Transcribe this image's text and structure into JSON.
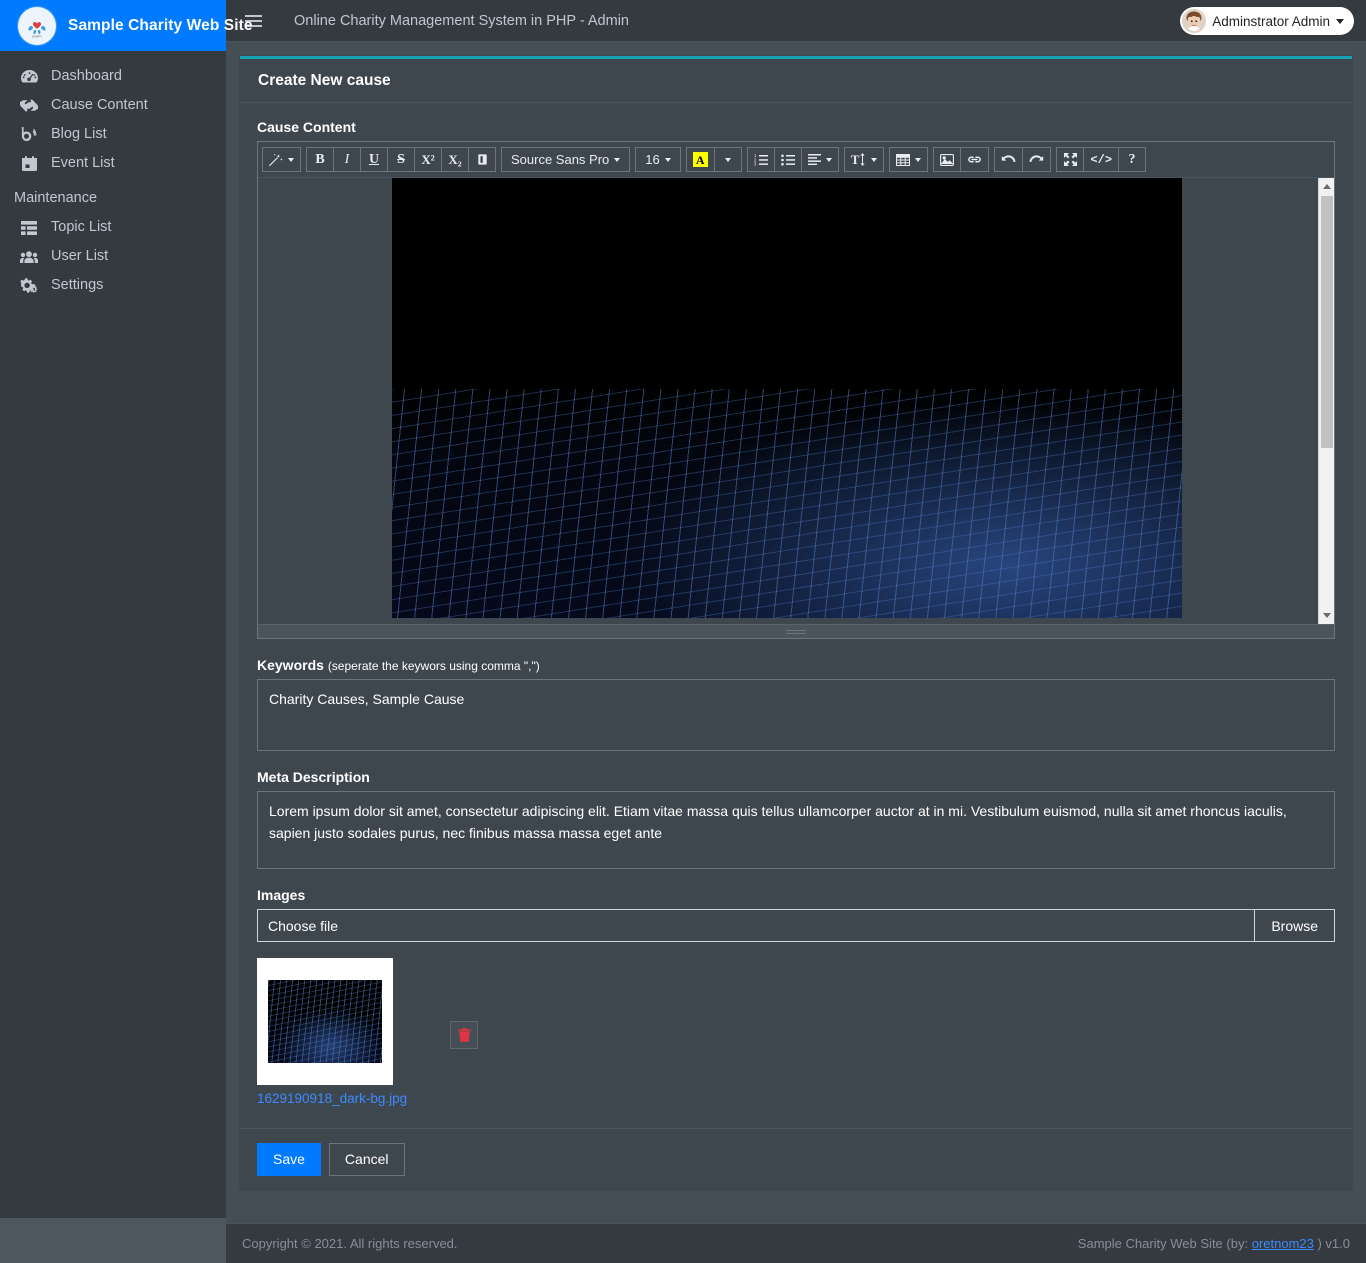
{
  "brand": {
    "name": "Sample Charity Web Site",
    "logo_icon": "charity-heart-hands-logo"
  },
  "sidebar": {
    "items": [
      {
        "label": "Dashboard",
        "icon": "tachometer-icon"
      },
      {
        "label": "Cause Content",
        "icon": "hands-helping-icon"
      },
      {
        "label": "Blog List",
        "icon": "blog-icon"
      },
      {
        "label": "Event List",
        "icon": "calendar-icon"
      }
    ],
    "section_header": "Maintenance",
    "maintenance_items": [
      {
        "label": "Topic List",
        "icon": "table-list-icon"
      },
      {
        "label": "User List",
        "icon": "users-icon"
      },
      {
        "label": "Settings",
        "icon": "cogs-icon"
      }
    ]
  },
  "topbar": {
    "menu_icon": "hamburger-icon",
    "title": "Online Charity Management System in PHP - Admin",
    "user": {
      "name": "Adminstrator Admin",
      "avatar_icon": "user-avatar",
      "caret_icon": "caret-down-icon"
    }
  },
  "page": {
    "card_title": "Create New cause",
    "accent_color": "#17a2b8"
  },
  "form": {
    "cause_content_label": "Cause Content",
    "keywords_label": "Keywords",
    "keywords_hint": "(seperate the keywors using comma \",\")",
    "keywords_value": "Charity Causes, Sample Cause",
    "meta_label": "Meta Description",
    "meta_value": "Lorem ipsum dolor sit amet, consectetur adipiscing elit. Etiam vitae massa quis tellus ullamcorper auctor at in mi. Vestibulum euismod, nulla sit amet rhoncus iaculis, sapien justo sodales purus, nec finibus massa massa eget ante",
    "images_label": "Images",
    "file_choose_text": "Choose file",
    "file_browse_text": "Browse",
    "uploaded_file_name": "1629190918_dark-bg.jpg",
    "delete_icon": "trash-icon",
    "save_label": "Save",
    "cancel_label": "Cancel"
  },
  "editor": {
    "toolbar": [
      {
        "group": [
          {
            "name": "magic-style-icon",
            "type": "icon",
            "caret": true
          }
        ]
      },
      {
        "group": [
          {
            "name": "bold-button",
            "type": "text",
            "label": "B",
            "style": "bold"
          },
          {
            "name": "italic-button",
            "type": "text",
            "label": "I",
            "style": "italic"
          },
          {
            "name": "underline-button",
            "type": "text",
            "label": "U",
            "style": "underline"
          },
          {
            "name": "strikethrough-button",
            "type": "text",
            "label": "S",
            "style": "strike"
          },
          {
            "name": "superscript-button",
            "type": "text",
            "label": "X²",
            "style": "plain"
          },
          {
            "name": "subscript-button",
            "type": "text",
            "label": "X₂",
            "style": "plain"
          },
          {
            "name": "eraser-button",
            "type": "icon"
          }
        ]
      },
      {
        "group": [
          {
            "name": "font-family-select",
            "type": "text",
            "label": "Source Sans Pro",
            "caret": true,
            "wide": true
          }
        ]
      },
      {
        "group": [
          {
            "name": "font-size-select",
            "type": "text",
            "label": "16",
            "caret": true,
            "wide": true
          }
        ]
      },
      {
        "group": [
          {
            "name": "font-color-button",
            "type": "fontcolor",
            "label": "A"
          },
          {
            "name": "font-color-dropdown",
            "type": "caretonly"
          }
        ]
      },
      {
        "group": [
          {
            "name": "ordered-list-button",
            "type": "icon"
          },
          {
            "name": "unordered-list-button",
            "type": "icon"
          },
          {
            "name": "paragraph-align-button",
            "type": "icon",
            "caret": true
          }
        ]
      },
      {
        "group": [
          {
            "name": "line-height-button",
            "type": "icon",
            "caret": true
          }
        ]
      },
      {
        "group": [
          {
            "name": "table-button",
            "type": "icon",
            "caret": true
          }
        ]
      },
      {
        "group": [
          {
            "name": "insert-image-button",
            "type": "icon"
          },
          {
            "name": "insert-link-button",
            "type": "icon"
          }
        ]
      },
      {
        "group": [
          {
            "name": "undo-button",
            "type": "icon"
          },
          {
            "name": "redo-button",
            "type": "icon"
          }
        ]
      },
      {
        "group": [
          {
            "name": "fullscreen-button",
            "type": "icon"
          },
          {
            "name": "code-view-button",
            "type": "text",
            "label": "</>",
            "style": "plain"
          },
          {
            "name": "help-button",
            "type": "text",
            "label": "?",
            "style": "bold"
          }
        ]
      }
    ],
    "content_image_alt": "dark blue wireframe grid background image"
  },
  "footer": {
    "copyright": "Copyright © 2021. All rights reserved.",
    "right_prefix": "Sample Charity Web Site (by:",
    "right_link": "oretnom23",
    "right_suffix": ") v1.0"
  }
}
